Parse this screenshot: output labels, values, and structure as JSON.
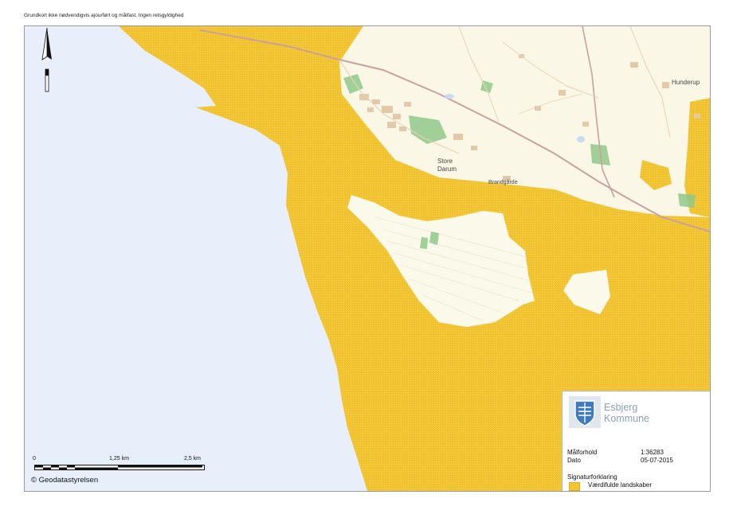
{
  "header": {
    "disclaimer": "Grundkort ikke nødvendigvis ajourført og målfast. Ingen retsgyldighed"
  },
  "map": {
    "place_labels": {
      "store": "Store",
      "darum": "Darum",
      "brandgaarde": "Brandgårde",
      "hunderup": "Hunderup"
    },
    "colors": {
      "sea": "#e8eefa",
      "land": "#fbf7e6",
      "landscape_highlight": "#f4c430",
      "forest": "#8fc98a",
      "road": "#c9a0a0",
      "buildings": "#e3c9a8"
    }
  },
  "north_arrow": {
    "icon": "north-arrow-icon"
  },
  "scalebar": {
    "ticks": [
      "0",
      "1,25 km",
      "2,5 km"
    ]
  },
  "copyright": "© Geodatastyrelsen",
  "legend": {
    "organization_line1": "Esbjerg",
    "organization_line2": "Kommune",
    "scale_label": "Målforhold",
    "scale_value": "1:36283",
    "date_label": "Dato",
    "date_value": "05-07-2015",
    "signature_title": "Signaturforklaring",
    "items": [
      {
        "label": "Værdifulde landskaber",
        "color": "#f4c430"
      }
    ]
  }
}
